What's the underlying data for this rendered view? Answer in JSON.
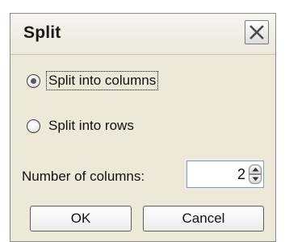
{
  "dialog": {
    "title": "Split",
    "close_icon": "close-icon"
  },
  "options": {
    "split_columns_label": "Split into columns",
    "split_rows_label": "Split into rows",
    "selected": "columns"
  },
  "columns": {
    "label": "Number of columns:",
    "value": "2"
  },
  "buttons": {
    "ok_label": "OK",
    "cancel_label": "Cancel"
  }
}
